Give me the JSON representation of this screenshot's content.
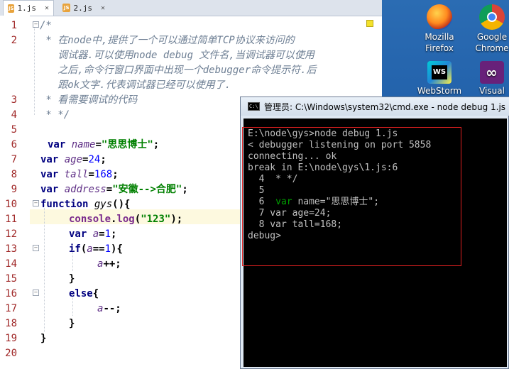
{
  "editor": {
    "tabs": [
      {
        "icon": "JS",
        "label": "1.js",
        "close": "✕"
      },
      {
        "icon": "JS",
        "label": "2.js",
        "close": "✕"
      }
    ],
    "line_numbers": [
      "1",
      "2",
      "",
      "",
      "",
      "3",
      "4",
      "5",
      "6",
      "7",
      "8",
      "9",
      "10",
      "11",
      "12",
      "13",
      "14",
      "15",
      "16",
      "17",
      "18",
      "19",
      "20"
    ],
    "code": {
      "l1": "/*",
      "l2a": " * 在node中,提供了一个可以通过简单TCP协议来访问的",
      "l2b": "   调试器.可以使用node debug 文件名,当调试器可以使用",
      "l2c": "   之后,命令行窗口界面中出现一个debugger命令提示符.后",
      "l2d": "   跟ok文字.代表调试器已经可以使用了.",
      "l3": " * 看需要调试的代码",
      "l4": " * */",
      "l6_kw": "var",
      "l6_var": "name",
      "l6_eq": "=",
      "l6_str": "\"思思博士\"",
      "l6_end": ";",
      "l7_kw": "var",
      "l7_var": "age",
      "l7_eq": "=",
      "l7_num": "24",
      "l7_end": ";",
      "l8_kw": "var",
      "l8_var": "tall",
      "l8_eq": "=",
      "l8_num": "168",
      "l8_end": ";",
      "l9_kw": "var",
      "l9_var": "address",
      "l9_eq": "=",
      "l9_str": "\"安徽-->合肥\"",
      "l9_end": ";",
      "l10_kw": "function",
      "l10_fn": "gys",
      "l10_end": "(){",
      "l11_obj": "console",
      "l11_dot": ".",
      "l11_m": "log",
      "l11_p1": "(",
      "l11_str": "\"123\"",
      "l11_p2": ");",
      "l12_kw": "var",
      "l12_var": "a",
      "l12_eq": "=",
      "l12_num": "1",
      "l12_end": ";",
      "l13_kw": "if",
      "l13_p": "(",
      "l13_var": "a",
      "l13_op": "==",
      "l13_num": "1",
      "l13_end": "){",
      "l14_var": "a",
      "l14_end": "++;",
      "l15": "}",
      "l16_kw": "else",
      "l16_end": "{",
      "l17_var": "a",
      "l17_end": "--;",
      "l18": "}",
      "l19": "}"
    }
  },
  "desktop": {
    "icons": [
      {
        "label1": "Mozilla",
        "label2": "Firefox",
        "icon": "firefox-icon"
      },
      {
        "label1": "Google",
        "label2": "Chrome",
        "icon": "chrome-icon"
      },
      {
        "label1": "WebStorm",
        "label2": "",
        "icon": "webstorm-icon"
      },
      {
        "label1": "Visual",
        "label2": "",
        "icon": "visual-studio-icon"
      }
    ]
  },
  "cmd": {
    "title": "管理员: C:\\Windows\\system32\\cmd.exe - node  debug 1.js",
    "lines": [
      "E:\\node\\gys>node debug 1.js",
      "< debugger listening on port 5858",
      "connecting... ok",
      "break in E:\\node\\gys\\1.js:6",
      "  4  * */",
      "  5",
      "  6  ",
      "  7 var age=24;",
      "  8 var tall=168;",
      "debug>"
    ],
    "line6_var": "var",
    "line6_rest": " name=\"思思博士\";"
  },
  "colors": {
    "accent_red": "#e02020",
    "current_line": "#fdf9df"
  }
}
